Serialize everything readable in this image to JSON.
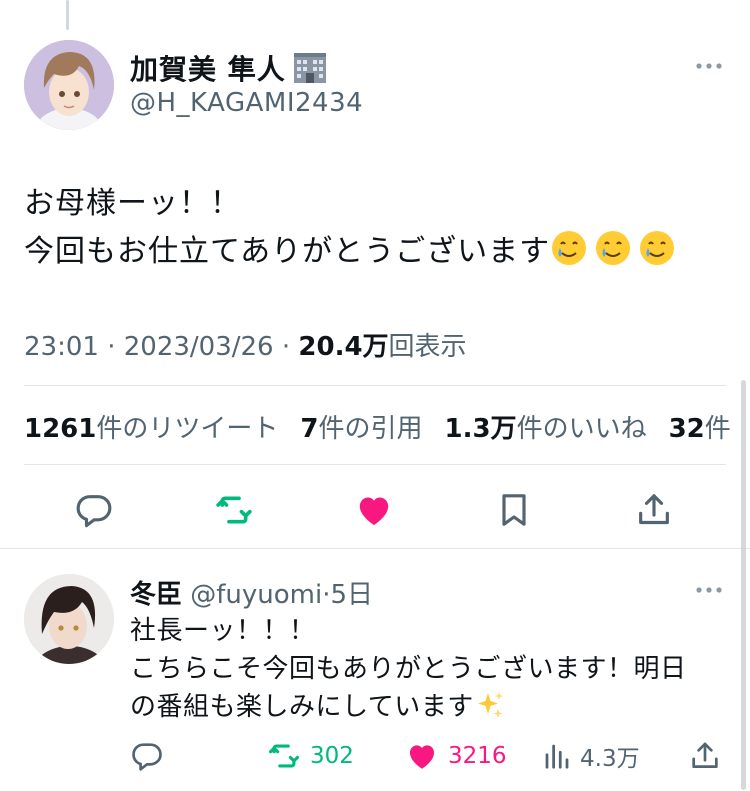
{
  "main_tweet": {
    "display_name": "加賀美 隼人",
    "name_badge_icon": "office-building-icon",
    "handle": "@H_KAGAMI2434",
    "text_line1": "お母様ーッ！！",
    "text_line2": "今回もお仕立てありがとうございます",
    "emojis": [
      "smiling-face-with-tear-icon",
      "smiling-face-with-tear-icon",
      "smiling-face-with-tear-icon"
    ],
    "time": "23:01",
    "separator": "·",
    "date": "2023/03/26",
    "views_count": "20.4万",
    "views_label": "回表示",
    "retweets_count": "1261",
    "retweets_label": "件のリツイート",
    "quotes_count": "7",
    "quotes_label": "件の引用",
    "likes_count": "1.3万",
    "likes_label": "件のいいね",
    "bookmarks_count": "32",
    "bookmarks_label": "件"
  },
  "reply": {
    "display_name": "冬臣",
    "handle": "@fuyuomi",
    "separator": "·",
    "time": "5日",
    "text_line1": "社長ーッ！！！",
    "text_line2": "こちらこそ今回もありがとうございます！明日",
    "text_line3": "の番組も楽しみにしています",
    "emoji": "sparkles-icon",
    "retweets": "302",
    "likes": "3216",
    "views": "4.3万"
  },
  "colors": {
    "text": "#0f1419",
    "secondary": "#536471",
    "retweet": "#00ba7c",
    "like": "#f91880",
    "divider": "#e1e6ea"
  }
}
